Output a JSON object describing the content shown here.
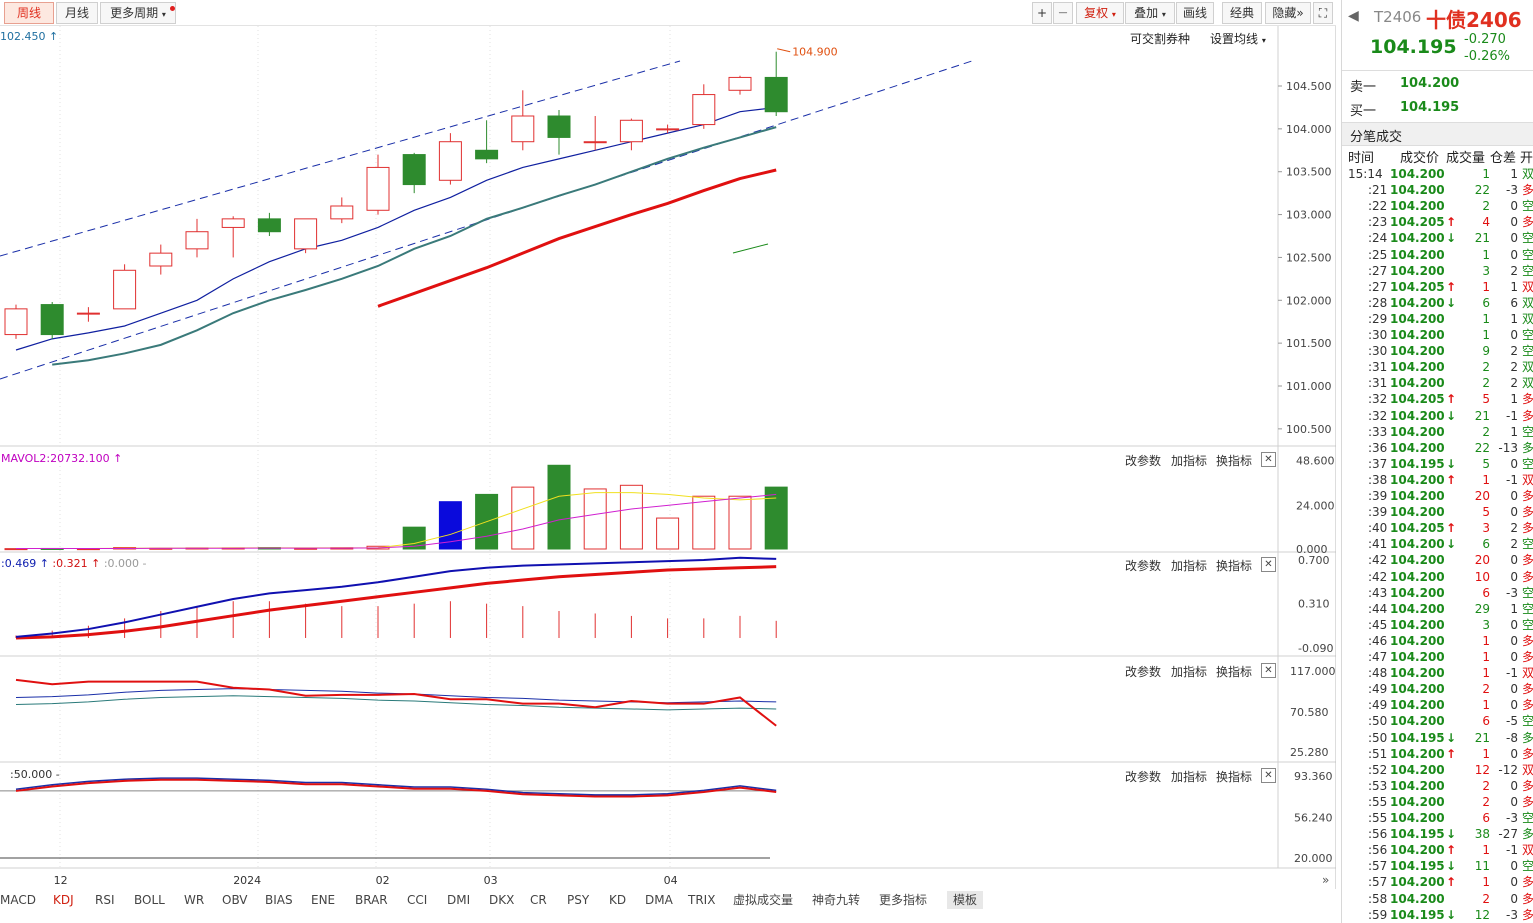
{
  "toolbar": {
    "tab_week": "周线",
    "tab_month": "月线",
    "more_period": "更多周期",
    "plus": "+",
    "minus": "—",
    "fuquan": "复权",
    "overlay": "叠加",
    "draw": "画线",
    "classic": "经典",
    "hide": "隐藏"
  },
  "main": {
    "top_price": "102.450",
    "deliverable": "可交割券种",
    "set_ma": "设置均线",
    "high_marker": "104.900",
    "price_ticks": [
      "104.500",
      "104.000",
      "103.500",
      "103.000",
      "102.500",
      "102.000",
      "101.500",
      "101.000",
      "100.500"
    ]
  },
  "panels": {
    "vol": {
      "label": "MAVOL2:20732.100",
      "ticks": [
        "48.600",
        "24.000",
        "0.000"
      ]
    },
    "kdj": {
      "label1": ":0.469",
      "label2": ":0.321",
      "label3": ":0.000 -",
      "ticks": [
        "0.700",
        "0.310",
        "-0.090"
      ]
    },
    "p3": {
      "ticks": [
        "117.000",
        "70.580",
        "25.280"
      ]
    },
    "p4": {
      "label": ":50.000 -",
      "ticks": [
        "93.360",
        "56.240",
        "20.000"
      ]
    },
    "buttons": {
      "params": "改参数",
      "add": "加指标",
      "swap": "换指标",
      "close": "✕"
    }
  },
  "xaxis": [
    "12",
    "2024",
    "02",
    "03",
    "04"
  ],
  "bottom_tabs": [
    "MACD",
    "KDJ",
    "RSI",
    "BOLL",
    "WR",
    "OBV",
    "BIAS",
    "ENE",
    "BRAR",
    "CCI",
    "DMI",
    "DKX",
    "CR",
    "PSY",
    "KD",
    "DMA",
    "TRIX",
    "虚拟成交量",
    "神奇九转",
    "更多指标",
    "模板"
  ],
  "quote": {
    "code": "T2406",
    "name": "十债2406",
    "price": "104.195",
    "change": "-0.270",
    "pct": "-0.26%",
    "sell_label": "卖一",
    "sell_price": "104.200",
    "buy_label": "买一",
    "buy_price": "104.195",
    "trades_title": "分笔成交",
    "headers": [
      "时间",
      "成交价",
      "成交量",
      "仓差",
      "开"
    ]
  },
  "trades": [
    {
      "t": "15:14",
      "p": "104.200",
      "a": "",
      "v": "1",
      "d": "1",
      "k": "双",
      "pc": "g",
      "vc": "g",
      "kc": "g"
    },
    {
      "t": ":21",
      "p": "104.200",
      "a": "",
      "v": "22",
      "d": "-3",
      "k": "多",
      "pc": "g",
      "vc": "g",
      "kc": "r"
    },
    {
      "t": ":22",
      "p": "104.200",
      "a": "",
      "v": "2",
      "d": "0",
      "k": "空",
      "pc": "g",
      "vc": "g",
      "kc": "g"
    },
    {
      "t": ":23",
      "p": "104.205",
      "a": "up",
      "v": "4",
      "d": "0",
      "k": "多",
      "pc": "g",
      "vc": "r",
      "kc": "r"
    },
    {
      "t": ":24",
      "p": "104.200",
      "a": "down",
      "v": "21",
      "d": "0",
      "k": "空",
      "pc": "g",
      "vc": "g",
      "kc": "g"
    },
    {
      "t": ":25",
      "p": "104.200",
      "a": "",
      "v": "1",
      "d": "0",
      "k": "空",
      "pc": "g",
      "vc": "g",
      "kc": "g"
    },
    {
      "t": ":27",
      "p": "104.200",
      "a": "",
      "v": "3",
      "d": "2",
      "k": "空",
      "pc": "g",
      "vc": "g",
      "kc": "g"
    },
    {
      "t": ":27",
      "p": "104.205",
      "a": "up",
      "v": "1",
      "d": "1",
      "k": "双",
      "pc": "g",
      "vc": "r",
      "kc": "r"
    },
    {
      "t": ":28",
      "p": "104.200",
      "a": "down",
      "v": "6",
      "d": "6",
      "k": "双",
      "pc": "g",
      "vc": "g",
      "kc": "g"
    },
    {
      "t": ":29",
      "p": "104.200",
      "a": "",
      "v": "1",
      "d": "1",
      "k": "双",
      "pc": "g",
      "vc": "g",
      "kc": "g"
    },
    {
      "t": ":30",
      "p": "104.200",
      "a": "",
      "v": "1",
      "d": "0",
      "k": "空",
      "pc": "g",
      "vc": "g",
      "kc": "g"
    },
    {
      "t": ":30",
      "p": "104.200",
      "a": "",
      "v": "9",
      "d": "2",
      "k": "空",
      "pc": "g",
      "vc": "g",
      "kc": "g"
    },
    {
      "t": ":31",
      "p": "104.200",
      "a": "",
      "v": "2",
      "d": "2",
      "k": "双",
      "pc": "g",
      "vc": "g",
      "kc": "g"
    },
    {
      "t": ":31",
      "p": "104.200",
      "a": "",
      "v": "2",
      "d": "2",
      "k": "双",
      "pc": "g",
      "vc": "g",
      "kc": "g"
    },
    {
      "t": ":32",
      "p": "104.205",
      "a": "up",
      "v": "5",
      "d": "1",
      "k": "多",
      "pc": "g",
      "vc": "r",
      "kc": "r"
    },
    {
      "t": ":32",
      "p": "104.200",
      "a": "down",
      "v": "21",
      "d": "-1",
      "k": "多",
      "pc": "g",
      "vc": "g",
      "kc": "r"
    },
    {
      "t": ":33",
      "p": "104.200",
      "a": "",
      "v": "2",
      "d": "1",
      "k": "空",
      "pc": "g",
      "vc": "g",
      "kc": "g"
    },
    {
      "t": ":36",
      "p": "104.200",
      "a": "",
      "v": "22",
      "d": "-13",
      "k": "多",
      "pc": "g",
      "vc": "g",
      "kc": "g"
    },
    {
      "t": ":37",
      "p": "104.195",
      "a": "down",
      "v": "5",
      "d": "0",
      "k": "空",
      "pc": "g",
      "vc": "g",
      "kc": "g"
    },
    {
      "t": ":38",
      "p": "104.200",
      "a": "up",
      "v": "1",
      "d": "-1",
      "k": "双",
      "pc": "g",
      "vc": "r",
      "kc": "r"
    },
    {
      "t": ":39",
      "p": "104.200",
      "a": "",
      "v": "20",
      "d": "0",
      "k": "多",
      "pc": "g",
      "vc": "r",
      "kc": "r"
    },
    {
      "t": ":39",
      "p": "104.200",
      "a": "",
      "v": "5",
      "d": "0",
      "k": "多",
      "pc": "g",
      "vc": "r",
      "kc": "r"
    },
    {
      "t": ":40",
      "p": "104.205",
      "a": "up",
      "v": "3",
      "d": "2",
      "k": "多",
      "pc": "g",
      "vc": "r",
      "kc": "r"
    },
    {
      "t": ":41",
      "p": "104.200",
      "a": "down",
      "v": "6",
      "d": "2",
      "k": "空",
      "pc": "g",
      "vc": "g",
      "kc": "g"
    },
    {
      "t": ":42",
      "p": "104.200",
      "a": "",
      "v": "20",
      "d": "0",
      "k": "多",
      "pc": "g",
      "vc": "r",
      "kc": "r"
    },
    {
      "t": ":42",
      "p": "104.200",
      "a": "",
      "v": "10",
      "d": "0",
      "k": "多",
      "pc": "g",
      "vc": "r",
      "kc": "r"
    },
    {
      "t": ":43",
      "p": "104.200",
      "a": "",
      "v": "6",
      "d": "-3",
      "k": "空",
      "pc": "g",
      "vc": "r",
      "kc": "g"
    },
    {
      "t": ":44",
      "p": "104.200",
      "a": "",
      "v": "29",
      "d": "1",
      "k": "空",
      "pc": "g",
      "vc": "g",
      "kc": "g"
    },
    {
      "t": ":45",
      "p": "104.200",
      "a": "",
      "v": "3",
      "d": "0",
      "k": "空",
      "pc": "g",
      "vc": "g",
      "kc": "g"
    },
    {
      "t": ":46",
      "p": "104.200",
      "a": "",
      "v": "1",
      "d": "0",
      "k": "多",
      "pc": "g",
      "vc": "r",
      "kc": "r"
    },
    {
      "t": ":47",
      "p": "104.200",
      "a": "",
      "v": "1",
      "d": "0",
      "k": "多",
      "pc": "g",
      "vc": "r",
      "kc": "r"
    },
    {
      "t": ":48",
      "p": "104.200",
      "a": "",
      "v": "1",
      "d": "-1",
      "k": "双",
      "pc": "g",
      "vc": "r",
      "kc": "r"
    },
    {
      "t": ":49",
      "p": "104.200",
      "a": "",
      "v": "2",
      "d": "0",
      "k": "多",
      "pc": "g",
      "vc": "r",
      "kc": "r"
    },
    {
      "t": ":49",
      "p": "104.200",
      "a": "",
      "v": "1",
      "d": "0",
      "k": "多",
      "pc": "g",
      "vc": "r",
      "kc": "r"
    },
    {
      "t": ":50",
      "p": "104.200",
      "a": "",
      "v": "6",
      "d": "-5",
      "k": "空",
      "pc": "g",
      "vc": "r",
      "kc": "g"
    },
    {
      "t": ":50",
      "p": "104.195",
      "a": "down",
      "v": "21",
      "d": "-8",
      "k": "多",
      "pc": "g",
      "vc": "g",
      "kc": "g"
    },
    {
      "t": ":51",
      "p": "104.200",
      "a": "up",
      "v": "1",
      "d": "0",
      "k": "多",
      "pc": "g",
      "vc": "r",
      "kc": "r"
    },
    {
      "t": ":52",
      "p": "104.200",
      "a": "",
      "v": "12",
      "d": "-12",
      "k": "双",
      "pc": "g",
      "vc": "r",
      "kc": "r"
    },
    {
      "t": ":53",
      "p": "104.200",
      "a": "",
      "v": "2",
      "d": "0",
      "k": "多",
      "pc": "g",
      "vc": "r",
      "kc": "r"
    },
    {
      "t": ":55",
      "p": "104.200",
      "a": "",
      "v": "2",
      "d": "0",
      "k": "多",
      "pc": "g",
      "vc": "r",
      "kc": "r"
    },
    {
      "t": ":55",
      "p": "104.200",
      "a": "",
      "v": "6",
      "d": "-3",
      "k": "空",
      "pc": "g",
      "vc": "r",
      "kc": "g"
    },
    {
      "t": ":56",
      "p": "104.195",
      "a": "down",
      "v": "38",
      "d": "-27",
      "k": "多",
      "pc": "g",
      "vc": "g",
      "kc": "g"
    },
    {
      "t": ":56",
      "p": "104.200",
      "a": "up",
      "v": "1",
      "d": "-1",
      "k": "双",
      "pc": "g",
      "vc": "r",
      "kc": "r"
    },
    {
      "t": ":57",
      "p": "104.195",
      "a": "down",
      "v": "11",
      "d": "0",
      "k": "空",
      "pc": "g",
      "vc": "g",
      "kc": "g"
    },
    {
      "t": ":57",
      "p": "104.200",
      "a": "up",
      "v": "1",
      "d": "0",
      "k": "多",
      "pc": "g",
      "vc": "r",
      "kc": "r"
    },
    {
      "t": ":58",
      "p": "104.200",
      "a": "",
      "v": "2",
      "d": "0",
      "k": "多",
      "pc": "g",
      "vc": "r",
      "kc": "r"
    },
    {
      "t": ":59",
      "p": "104.195",
      "a": "down",
      "v": "12",
      "d": "-3",
      "k": "多",
      "pc": "g",
      "vc": "g",
      "kc": "r"
    }
  ],
  "chart_data": {
    "type": "candlestick",
    "series": [
      {
        "name": "K",
        "ohlc": [
          [
            101.6,
            101.9,
            101.55,
            101.95
          ],
          [
            101.95,
            101.6,
            101.55,
            101.98
          ],
          [
            101.85,
            101.85,
            101.75,
            101.92
          ],
          [
            101.9,
            102.35,
            101.9,
            102.42
          ],
          [
            102.4,
            102.55,
            102.3,
            102.65
          ],
          [
            102.6,
            102.8,
            102.5,
            102.95
          ],
          [
            102.85,
            102.95,
            102.5,
            102.98
          ],
          [
            102.95,
            102.8,
            102.75,
            103.02
          ],
          [
            102.6,
            102.95,
            102.55,
            102.95
          ],
          [
            102.95,
            103.1,
            102.9,
            103.2
          ],
          [
            103.05,
            103.55,
            103.0,
            103.7
          ],
          [
            103.7,
            103.35,
            103.25,
            103.72
          ],
          [
            103.4,
            103.85,
            103.35,
            103.95
          ],
          [
            103.75,
            103.65,
            103.6,
            104.1
          ],
          [
            103.85,
            104.15,
            103.75,
            104.45
          ],
          [
            104.15,
            103.9,
            103.7,
            104.22
          ],
          [
            103.85,
            103.85,
            103.75,
            104.15
          ],
          [
            103.85,
            104.1,
            103.75,
            104.12
          ],
          [
            104.0,
            104.0,
            103.95,
            104.05
          ],
          [
            104.05,
            104.4,
            104.0,
            104.52
          ],
          [
            104.45,
            104.6,
            104.4,
            104.62
          ],
          [
            104.6,
            104.2,
            104.15,
            104.9
          ]
        ]
      },
      {
        "name": "MA1",
        "values": [
          101.42,
          101.55,
          101.62,
          101.7,
          101.85,
          102.0,
          102.25,
          102.45,
          102.6,
          102.7,
          102.85,
          103.05,
          103.2,
          103.4,
          103.55,
          103.65,
          103.75,
          103.85,
          103.95,
          104.05,
          104.2,
          104.25
        ]
      },
      {
        "name": "MA2",
        "values": [
          null,
          101.25,
          101.3,
          101.38,
          101.48,
          101.65,
          101.85,
          102.0,
          102.12,
          102.25,
          102.4,
          102.6,
          102.75,
          102.95,
          103.08,
          103.22,
          103.35,
          103.5,
          103.65,
          103.78,
          103.9,
          104.02
        ]
      },
      {
        "name": "MA3",
        "values": [
          null,
          null,
          null,
          null,
          null,
          null,
          null,
          null,
          null,
          null,
          101.93,
          102.08,
          102.23,
          102.38,
          102.55,
          102.72,
          102.86,
          103.0,
          103.13,
          103.28,
          103.42,
          103.52
        ]
      },
      {
        "name": "VOL",
        "values": [
          0.2,
          0.3,
          0.2,
          0.8,
          0.4,
          0.6,
          0.6,
          0.8,
          0.4,
          0.7,
          1.5,
          12,
          26,
          30,
          34,
          46,
          33,
          35,
          17,
          29,
          29,
          34
        ]
      },
      {
        "name": "DIF",
        "values": [
          0.01,
          0.04,
          0.08,
          0.14,
          0.21,
          0.28,
          0.35,
          0.4,
          0.43,
          0.46,
          0.5,
          0.55,
          0.6,
          0.63,
          0.65,
          0.66,
          0.67,
          0.68,
          0.69,
          0.7,
          0.72,
          0.71
        ]
      },
      {
        "name": "DEA",
        "values": [
          0.0,
          0.01,
          0.03,
          0.06,
          0.1,
          0.15,
          0.2,
          0.25,
          0.29,
          0.33,
          0.37,
          0.41,
          0.45,
          0.49,
          0.52,
          0.55,
          0.57,
          0.59,
          0.61,
          0.62,
          0.63,
          0.64
        ]
      },
      {
        "name": "RSI1",
        "values": [
          107,
          102,
          105,
          105,
          105,
          105,
          98,
          96,
          89,
          90,
          90,
          91,
          85,
          85,
          80,
          80,
          76,
          83,
          80,
          80,
          87,
          55
        ]
      },
      {
        "name": "RSI2",
        "values": [
          87,
          88,
          90,
          93,
          95,
          96,
          97,
          96,
          95,
          94,
          92,
          91,
          89,
          87,
          86,
          84,
          83,
          82,
          81,
          82,
          83,
          82
        ]
      },
      {
        "name": "K1",
        "values": [
          80,
          84,
          87,
          89,
          90,
          90,
          89,
          88,
          86,
          86,
          84,
          82,
          82,
          80,
          77,
          76,
          75,
          75,
          76,
          79,
          83,
          79
        ]
      }
    ],
    "xticks": [
      "12",
      "2024",
      "02",
      "03",
      "04"
    ],
    "ylim": [
      100.3,
      105.2
    ]
  }
}
